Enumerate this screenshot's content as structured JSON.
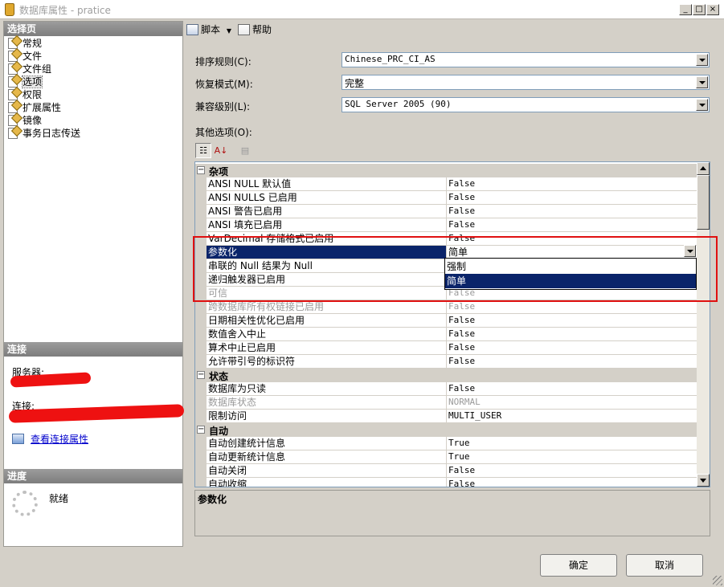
{
  "window": {
    "title": "数据库属性 - pratice",
    "buttons": {
      "minimize": "_",
      "maximize": "□",
      "close": "×"
    }
  },
  "left_pane": {
    "select_page_header": "选择页",
    "pages": [
      {
        "label": "常规",
        "selected": false
      },
      {
        "label": "文件",
        "selected": false
      },
      {
        "label": "文件组",
        "selected": false
      },
      {
        "label": "选项",
        "selected": true
      },
      {
        "label": "权限",
        "selected": false
      },
      {
        "label": "扩展属性",
        "selected": false
      },
      {
        "label": "镜像",
        "selected": false
      },
      {
        "label": "事务日志传送",
        "selected": false
      }
    ],
    "connection_header": "连接",
    "server_label": "服务器:",
    "connection_label": "连接:",
    "view_connection_link": "查看连接属性",
    "progress_header": "进度",
    "progress_status": "就绪"
  },
  "toolbar": {
    "script_label": "脚本",
    "help_label": "帮助"
  },
  "form": {
    "collation_label": "排序规则(C):",
    "collation_value": "Chinese_PRC_CI_AS",
    "recovery_label": "恢复模式(M):",
    "recovery_value": "完整",
    "compat_label": "兼容级别(L):",
    "compat_value": "SQL Server 2005 (90)",
    "other_options_label": "其他选项(O):"
  },
  "grid": {
    "rows": [
      {
        "kind": "cat",
        "name": "杂项",
        "expander": "−"
      },
      {
        "kind": "prop",
        "name": "ANSI NULL 默认值",
        "value": "False"
      },
      {
        "kind": "prop",
        "name": "ANSI NULLS 已启用",
        "value": "False"
      },
      {
        "kind": "prop",
        "name": "ANSI 警告已启用",
        "value": "False"
      },
      {
        "kind": "prop",
        "name": "ANSI 填充已启用",
        "value": "False"
      },
      {
        "kind": "prop",
        "name": "VarDecimal 存储格式已启用",
        "value": "False"
      },
      {
        "kind": "prop",
        "name": "参数化",
        "value": "简单",
        "selected": true
      },
      {
        "kind": "prop",
        "name": "串联的 Null 结果为 Null",
        "value": ""
      },
      {
        "kind": "prop",
        "name": "递归触发器已启用",
        "value": ""
      },
      {
        "kind": "prop",
        "name": "可信",
        "value": "False",
        "disabled": true
      },
      {
        "kind": "prop",
        "name": "跨数据库所有权链接已启用",
        "value": "False",
        "disabled": true
      },
      {
        "kind": "prop",
        "name": "日期相关性优化已启用",
        "value": "False"
      },
      {
        "kind": "prop",
        "name": "数值舍入中止",
        "value": "False"
      },
      {
        "kind": "prop",
        "name": "算术中止已启用",
        "value": "False"
      },
      {
        "kind": "prop",
        "name": "允许带引号的标识符",
        "value": "False"
      },
      {
        "kind": "cat",
        "name": "状态",
        "expander": "−"
      },
      {
        "kind": "prop",
        "name": "数据库为只读",
        "value": "False"
      },
      {
        "kind": "prop",
        "name": "数据库状态",
        "value": "NORMAL",
        "disabled": true
      },
      {
        "kind": "prop",
        "name": "限制访问",
        "value": "MULTI_USER"
      },
      {
        "kind": "cat",
        "name": "自动",
        "expander": "−"
      },
      {
        "kind": "prop",
        "name": "自动创建统计信息",
        "value": "True"
      },
      {
        "kind": "prop",
        "name": "自动更新统计信息",
        "value": "True"
      },
      {
        "kind": "prop",
        "name": "自动关闭",
        "value": "False"
      },
      {
        "kind": "prop",
        "name": "自动收缩",
        "value": "False"
      }
    ],
    "dropdown_options": [
      {
        "label": "强制",
        "highlighted": false
      },
      {
        "label": "简单",
        "highlighted": true
      }
    ]
  },
  "description": {
    "title": "参数化"
  },
  "buttons": {
    "ok": "确定",
    "cancel": "取消"
  },
  "colors": {
    "selection": "#0a246a",
    "annotation": "#e01010",
    "redaction": "#ee1111"
  }
}
